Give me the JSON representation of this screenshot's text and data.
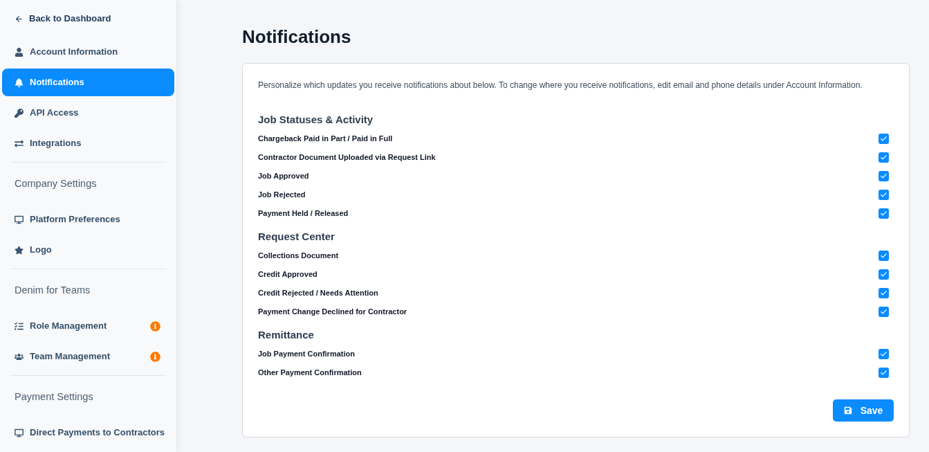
{
  "back_link": {
    "label": "Back to Dashboard"
  },
  "sidebar": {
    "sections": [
      {
        "items": [
          {
            "label": "Account Information",
            "selected": false
          },
          {
            "label": "Notifications",
            "selected": true
          },
          {
            "label": "API Access",
            "selected": false
          },
          {
            "label": "Integrations",
            "selected": false
          }
        ]
      },
      {
        "heading": "Company Settings",
        "items": [
          {
            "label": "Platform Preferences",
            "selected": false
          },
          {
            "label": "Logo",
            "selected": false
          }
        ]
      },
      {
        "heading": "Denim for Teams",
        "items": [
          {
            "label": "Role Management",
            "selected": false,
            "alert": true
          },
          {
            "label": "Team Management",
            "selected": false,
            "alert": true
          }
        ]
      },
      {
        "heading": "Payment Settings",
        "items": [
          {
            "label": "Direct Payments to Contractors",
            "selected": false
          }
        ]
      }
    ]
  },
  "page": {
    "title": "Notifications"
  },
  "card": {
    "description": "Personalize which updates you receive notifications about below. To change where you receive notifications, edit email and phone details under Account Information.",
    "groups": [
      {
        "heading": "Job Statuses & Activity",
        "options": [
          {
            "label": "Chargeback Paid in Part / Paid in Full",
            "checked": true
          },
          {
            "label": "Contractor Document Uploaded via Request Link",
            "checked": true
          },
          {
            "label": "Job Approved",
            "checked": true
          },
          {
            "label": "Job Rejected",
            "checked": true
          },
          {
            "label": "Payment Held / Released",
            "checked": true
          }
        ]
      },
      {
        "heading": "Request Center",
        "options": [
          {
            "label": "Collections Document",
            "checked": true
          },
          {
            "label": "Credit Approved",
            "checked": true
          },
          {
            "label": "Credit Rejected / Needs Attention",
            "checked": true
          },
          {
            "label": "Payment Change Declined for Contractor",
            "checked": true
          }
        ]
      },
      {
        "heading": "Remittance",
        "options": [
          {
            "label": "Job Payment Confirmation",
            "checked": true
          },
          {
            "label": "Other Payment Confirmation",
            "checked": true
          }
        ]
      }
    ],
    "save_button": {
      "label": "Save"
    }
  }
}
